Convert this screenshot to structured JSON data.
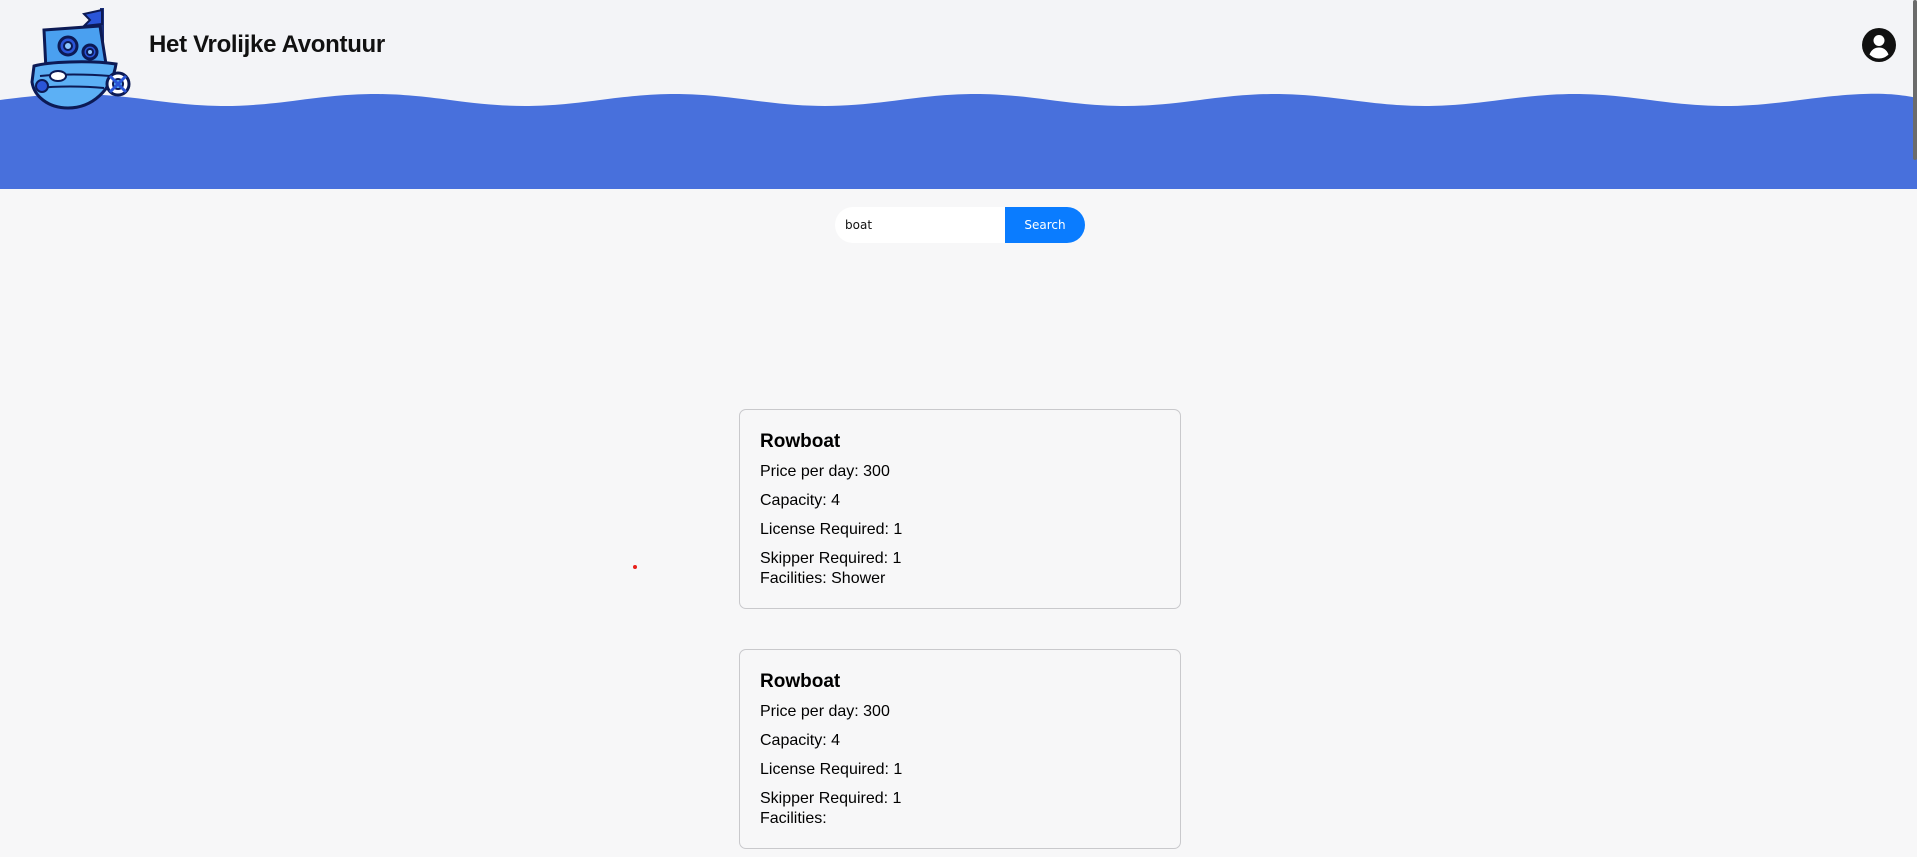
{
  "header": {
    "title": "Het Vrolijke Avontuur",
    "logo_icon": "boat-logo-icon",
    "account_icon": "account-circle-icon",
    "wave_color": "#4870dc"
  },
  "search": {
    "value": "boat",
    "button_label": "Search",
    "button_color": "#0a7cff"
  },
  "results": [
    {
      "name": "Rowboat",
      "price": "Price per day: 300",
      "capacity": "Capacity: 4",
      "license": "License Required: 1",
      "skipper": "Skipper Required: 1",
      "facilities": "Facilities: Shower"
    },
    {
      "name": "Rowboat",
      "price": "Price per day: 300",
      "capacity": "Capacity: 4",
      "license": "License Required: 1",
      "skipper": "Skipper Required: 1",
      "facilities": "Facilities:"
    }
  ]
}
